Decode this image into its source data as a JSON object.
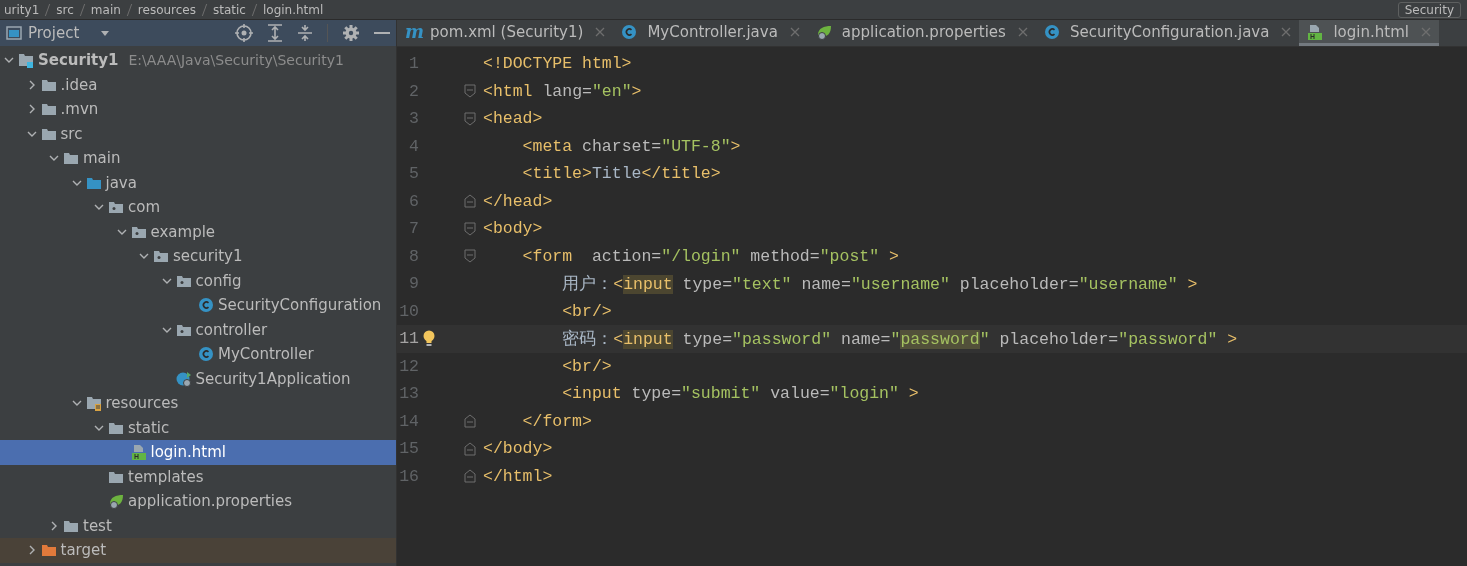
{
  "breadcrumb": {
    "items": [
      "urity1",
      "src",
      "main",
      "resources",
      "static",
      "login.html"
    ],
    "run_config": "Security"
  },
  "project_panel": {
    "title": "Project",
    "tree": [
      {
        "label": "Security1",
        "path": "E:\\AAA\\Java\\Security\\Security1",
        "kind": "module",
        "expandable": true,
        "expanded": true,
        "selected": false,
        "children": [
          {
            "label": ".idea",
            "kind": "folder",
            "expandable": true,
            "expanded": false,
            "selected": false
          },
          {
            "label": ".mvn",
            "kind": "folder",
            "expandable": true,
            "expanded": false,
            "selected": false
          },
          {
            "label": "src",
            "kind": "folder",
            "expandable": true,
            "expanded": true,
            "selected": false,
            "children": [
              {
                "label": "main",
                "kind": "folder",
                "expandable": true,
                "expanded": true,
                "selected": false,
                "children": [
                  {
                    "label": "java",
                    "kind": "source",
                    "expandable": true,
                    "expanded": true,
                    "selected": false,
                    "children": [
                      {
                        "label": "com",
                        "kind": "package",
                        "expandable": true,
                        "expanded": true,
                        "selected": false,
                        "children": [
                          {
                            "label": "example",
                            "kind": "package",
                            "expandable": true,
                            "expanded": true,
                            "selected": false,
                            "children": [
                              {
                                "label": "security1",
                                "kind": "package",
                                "expandable": true,
                                "expanded": true,
                                "selected": false,
                                "children": [
                                  {
                                    "label": "config",
                                    "kind": "package",
                                    "expandable": true,
                                    "expanded": true,
                                    "selected": false,
                                    "children": [
                                      {
                                        "label": "SecurityConfiguration",
                                        "kind": "class",
                                        "expandable": false,
                                        "expanded": false,
                                        "selected": false
                                      }
                                    ]
                                  },
                                  {
                                    "label": "controller",
                                    "kind": "package",
                                    "expandable": true,
                                    "expanded": true,
                                    "selected": false,
                                    "children": [
                                      {
                                        "label": "MyController",
                                        "kind": "class",
                                        "expandable": false,
                                        "expanded": false,
                                        "selected": false
                                      }
                                    ]
                                  },
                                  {
                                    "label": "Security1Application",
                                    "kind": "spring-class",
                                    "expandable": false,
                                    "expanded": false,
                                    "selected": false
                                  }
                                ]
                              }
                            ]
                          }
                        ]
                      }
                    ]
                  },
                  {
                    "label": "resources",
                    "kind": "resources",
                    "expandable": true,
                    "expanded": true,
                    "selected": false,
                    "children": [
                      {
                        "label": "static",
                        "kind": "folder",
                        "expandable": true,
                        "expanded": true,
                        "selected": false,
                        "children": [
                          {
                            "label": "login.html",
                            "kind": "html",
                            "expandable": false,
                            "expanded": false,
                            "selected": true
                          }
                        ]
                      },
                      {
                        "label": "templates",
                        "kind": "folder",
                        "expandable": false,
                        "expanded": false,
                        "selected": false
                      },
                      {
                        "label": "application.properties",
                        "kind": "properties",
                        "expandable": false,
                        "expanded": false,
                        "selected": false
                      }
                    ]
                  }
                ]
              },
              {
                "label": "test",
                "kind": "folder",
                "expandable": true,
                "expanded": false,
                "selected": false
              }
            ]
          },
          {
            "label": "target",
            "kind": "excluded",
            "expandable": true,
            "expanded": false,
            "selected": false
          }
        ]
      }
    ]
  },
  "tabs": [
    {
      "label": "pom.xml (Security1)",
      "kind": "maven",
      "icon_text": "m",
      "selected": false
    },
    {
      "label": "MyController.java",
      "kind": "class",
      "selected": false
    },
    {
      "label": "application.properties",
      "kind": "properties",
      "selected": false
    },
    {
      "label": "SecurityConfiguration.java",
      "kind": "class",
      "selected": false
    },
    {
      "label": "login.html",
      "kind": "html",
      "selected": true
    }
  ],
  "editor": {
    "lines": [
      {
        "number": "1",
        "fold_start": false,
        "fold_end": false,
        "current": false,
        "tokens": [
          {
            "kind": "tag",
            "text": "<!DOCTYPE html>"
          }
        ]
      },
      {
        "number": "2",
        "fold_start": true,
        "fold_end": false,
        "current": false,
        "tokens": [
          {
            "kind": "tag",
            "text": "<html "
          },
          {
            "kind": "attr",
            "text": "lang="
          },
          {
            "kind": "value",
            "text": "\"en\""
          },
          {
            "kind": "tag",
            "text": ">"
          }
        ]
      },
      {
        "number": "3",
        "fold_start": true,
        "fold_end": false,
        "current": false,
        "tokens": [
          {
            "kind": "tag",
            "text": "<head>"
          }
        ]
      },
      {
        "number": "4",
        "fold_start": false,
        "fold_end": false,
        "current": false,
        "tokens": [
          {
            "kind": "tag",
            "text": "    <meta "
          },
          {
            "kind": "attr",
            "text": "charset="
          },
          {
            "kind": "value",
            "text": "\"UTF-8\""
          },
          {
            "kind": "tag",
            "text": ">"
          }
        ]
      },
      {
        "number": "5",
        "fold_start": false,
        "fold_end": false,
        "current": false,
        "tokens": [
          {
            "kind": "tag",
            "text": "    <title>"
          },
          {
            "kind": "text",
            "text": "Title"
          },
          {
            "kind": "tag",
            "text": "</title>"
          }
        ]
      },
      {
        "number": "6",
        "fold_start": false,
        "fold_end": true,
        "current": false,
        "tokens": [
          {
            "kind": "tag",
            "text": "</head>"
          }
        ]
      },
      {
        "number": "7",
        "fold_start": true,
        "fold_end": false,
        "current": false,
        "tokens": [
          {
            "kind": "tag",
            "text": "<body>"
          }
        ]
      },
      {
        "number": "8",
        "fold_start": true,
        "fold_end": false,
        "current": false,
        "tokens": [
          {
            "kind": "tag",
            "text": "    <form  "
          },
          {
            "kind": "attr",
            "text": "action="
          },
          {
            "kind": "value",
            "text": "\"/login\" "
          },
          {
            "kind": "attr",
            "text": "method="
          },
          {
            "kind": "value",
            "text": "\"post\" "
          },
          {
            "kind": "tag",
            "text": ">"
          }
        ]
      },
      {
        "number": "9",
        "fold_start": false,
        "fold_end": false,
        "current": false,
        "tokens": [
          {
            "kind": "text",
            "text": "        用户："
          },
          {
            "kind": "tag",
            "text": "<"
          },
          {
            "kind": "tag-usage",
            "text": "input"
          },
          {
            "kind": "attr",
            "text": " type="
          },
          {
            "kind": "value",
            "text": "\"text\" "
          },
          {
            "kind": "attr",
            "text": "name="
          },
          {
            "kind": "value",
            "text": "\"username\" "
          },
          {
            "kind": "attr",
            "text": "placeholder="
          },
          {
            "kind": "value",
            "text": "\"username\" "
          },
          {
            "kind": "tag",
            "text": ">"
          }
        ]
      },
      {
        "number": "10",
        "fold_start": false,
        "fold_end": false,
        "current": false,
        "tokens": [
          {
            "kind": "tag",
            "text": "        <br/>"
          }
        ]
      },
      {
        "number": "11",
        "fold_start": false,
        "fold_end": false,
        "current": true,
        "tokens": [
          {
            "kind": "text",
            "text": "        密码："
          },
          {
            "kind": "tag",
            "text": "<"
          },
          {
            "kind": "tag-usage",
            "text": "input"
          },
          {
            "kind": "attr",
            "text": " type="
          },
          {
            "kind": "value",
            "text": "\"password\" "
          },
          {
            "kind": "attr",
            "text": "name="
          },
          {
            "kind": "value",
            "text": "\""
          },
          {
            "kind": "value-warning",
            "text": "password"
          },
          {
            "kind": "value",
            "text": "\" "
          },
          {
            "kind": "attr",
            "text": "placeholder="
          },
          {
            "kind": "value",
            "text": "\"password\" "
          },
          {
            "kind": "tag",
            "text": ">"
          }
        ]
      },
      {
        "number": "12",
        "fold_start": false,
        "fold_end": false,
        "current": false,
        "tokens": [
          {
            "kind": "tag",
            "text": "        <br/>"
          }
        ]
      },
      {
        "number": "13",
        "fold_start": false,
        "fold_end": false,
        "current": false,
        "tokens": [
          {
            "kind": "tag",
            "text": "        <input "
          },
          {
            "kind": "attr",
            "text": "type="
          },
          {
            "kind": "value",
            "text": "\"submit\" "
          },
          {
            "kind": "attr",
            "text": "value="
          },
          {
            "kind": "value",
            "text": "\"login\" "
          },
          {
            "kind": "tag",
            "text": ">"
          }
        ]
      },
      {
        "number": "14",
        "fold_start": false,
        "fold_end": true,
        "current": false,
        "tokens": [
          {
            "kind": "tag",
            "text": "    </form>"
          }
        ]
      },
      {
        "number": "15",
        "fold_start": false,
        "fold_end": true,
        "current": false,
        "tokens": [
          {
            "kind": "tag",
            "text": "</body>"
          }
        ]
      },
      {
        "number": "16",
        "fold_start": false,
        "fold_end": true,
        "current": false,
        "tokens": [
          {
            "kind": "tag",
            "text": "</html>"
          }
        ]
      }
    ]
  }
}
